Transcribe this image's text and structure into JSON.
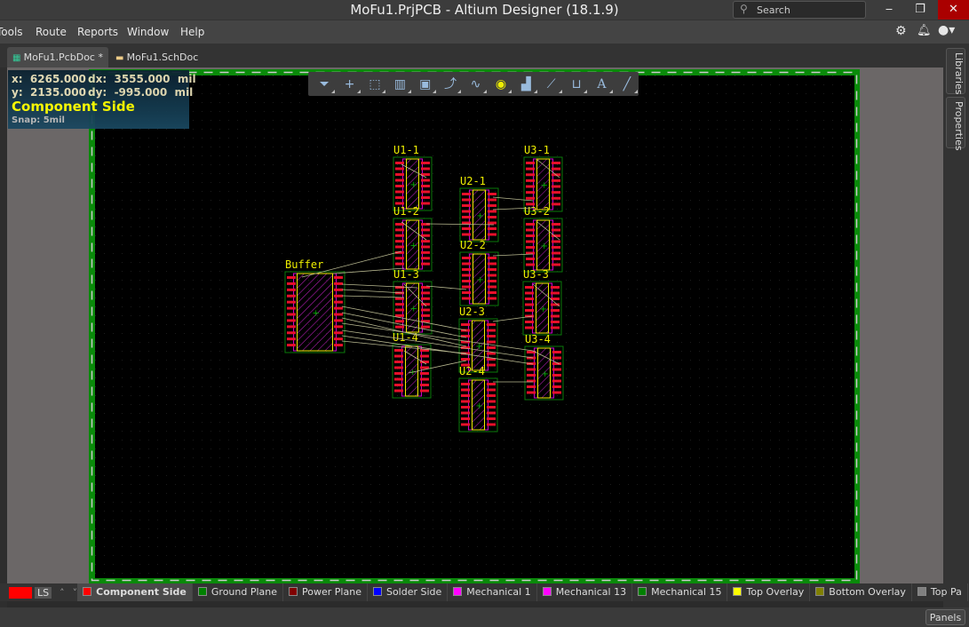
{
  "window": {
    "title": "MoFu1.PrjPCB - Altium Designer (18.1.9)",
    "search_placeholder": "Search",
    "minimize": "‒",
    "restore": "❐",
    "close": "✕"
  },
  "menu": [
    "Tools",
    "Route",
    "Reports",
    "Window",
    "Help"
  ],
  "tabs": [
    {
      "label": "MoFu1.PcbDoc *",
      "icon": "pcb-doc-icon"
    },
    {
      "label": "MoFu1.SchDoc",
      "icon": "sch-doc-icon"
    }
  ],
  "hud": {
    "x": "x:  6265.000",
    "dx": "dx:  3555.000  mil",
    "y": "y:  2135.000",
    "dy": "dy:  -995.000  mil",
    "layer": "Component Side",
    "snap": "Snap: 5mil",
    "layer_color": "#ffff00"
  },
  "toolbar": [
    "filter-icon",
    "cross-icon",
    "select-rect-icon",
    "align-icon",
    "component-icon",
    "route-icon",
    "interactive-route-icon",
    "pad-icon",
    "polygon-icon",
    "track-icon",
    "dimension-icon",
    "text-icon",
    "line-icon"
  ],
  "right_panels": [
    "Libraries",
    "Properties"
  ],
  "components": [
    "Buffer",
    "U1-1",
    "U1-2",
    "U1-3",
    "U1-4",
    "U2-1",
    "U2-2",
    "U2-3",
    "U2-4",
    "U3-1",
    "U3-2",
    "U3-3",
    "U3-4"
  ],
  "layer_set": "LS",
  "layers": [
    {
      "name": "Component Side",
      "color": "#ff0000"
    },
    {
      "name": "Ground Plane",
      "color": "#008000"
    },
    {
      "name": "Power Plane",
      "color": "#800000"
    },
    {
      "name": "Solder Side",
      "color": "#0000ff"
    },
    {
      "name": "Mechanical 1",
      "color": "#ff00ff"
    },
    {
      "name": "Mechanical 13",
      "color": "#ff00ff"
    },
    {
      "name": "Mechanical 15",
      "color": "#008000"
    },
    {
      "name": "Top Overlay",
      "color": "#ffff00"
    },
    {
      "name": "Bottom Overlay",
      "color": "#808000"
    },
    {
      "name": "Top Pa",
      "color": "#808080"
    }
  ],
  "status": {
    "panels": "Panels"
  }
}
